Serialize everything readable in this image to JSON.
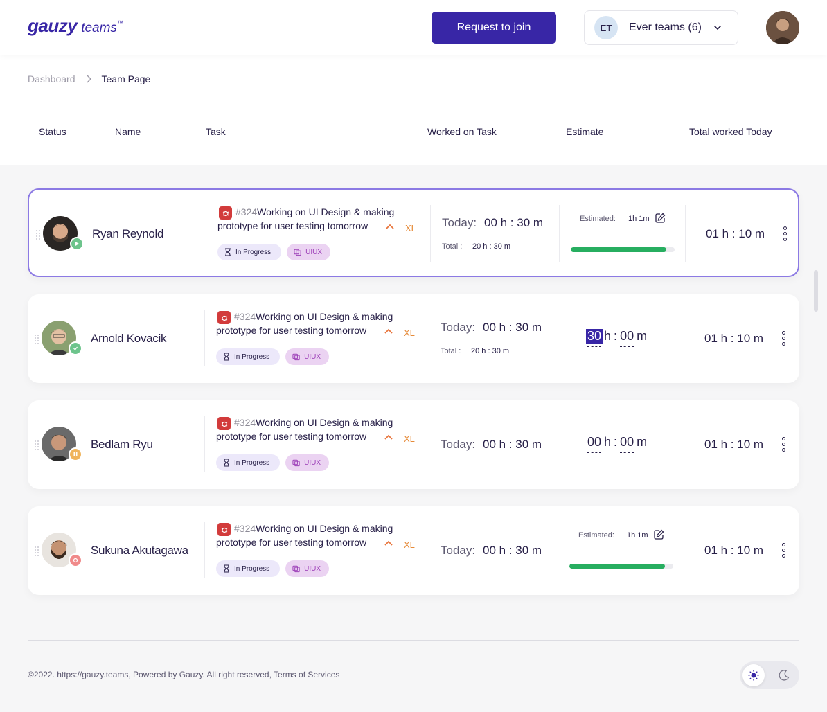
{
  "header": {
    "logo_main": "gauzy",
    "logo_sub": "teams",
    "logo_tm": "™",
    "join_button": "Request to join",
    "team_badge": "ET",
    "team_name": "Ever teams (6)"
  },
  "breadcrumb": {
    "parent": "Dashboard",
    "current": "Team Page"
  },
  "columns": {
    "status": "Status",
    "name": "Name",
    "task": "Task",
    "worked": "Worked on Task",
    "estimate": "Estimate",
    "total": "Total worked Today"
  },
  "colors": {
    "accent": "#3826a6",
    "progress": "#27ae60",
    "size": "#e68a38",
    "bug": "#d23b3b"
  },
  "rows": [
    {
      "name": "Ryan Reynold",
      "status": "working",
      "status_icon": "play-icon",
      "task_num": "#324",
      "task_title": "Working on UI Design & making prototype for user testing tomorrow",
      "size": "XL",
      "task_status": "In Progress",
      "task_label": "UIUX",
      "today_label": "Today:",
      "today_value": "00 h : 30 m",
      "total_label": "Total :",
      "total_value": "20 h : 30 m",
      "estimate_label": "Estimated:",
      "estimate_value": "1h 1m",
      "progress": 0.92,
      "worked_today": "01 h : 10 m"
    },
    {
      "name": "Arnold Kovacik",
      "status": "online",
      "status_icon": "check-icon",
      "task_num": "#324",
      "task_title": "Working on UI Design & making prototype for user testing tomorrow",
      "size": "XL",
      "task_status": "In Progress",
      "task_label": "UIUX",
      "today_label": "Today:",
      "today_value": "00 h : 30 m",
      "total_label": "Total :",
      "total_value": "20 h : 30 m",
      "est_hours": "30",
      "est_h_unit": "h",
      "est_colon": ":",
      "est_minutes": "00",
      "est_m_unit": "m",
      "worked_today": "01 h : 10 m"
    },
    {
      "name": "Bedlam Ryu",
      "status": "paused",
      "status_icon": "pause-icon",
      "task_num": "#324",
      "task_title": "Working on UI Design & making prototype for user testing tomorrow",
      "size": "XL",
      "task_status": "In Progress",
      "task_label": "UIUX",
      "today_label": "Today:",
      "today_value": "00 h : 30 m",
      "est_hours": "00",
      "est_h_unit": "h",
      "est_colon": ":",
      "est_minutes": "00",
      "est_m_unit": "m",
      "worked_today": "01 h : 10 m"
    },
    {
      "name": "Sukuna Akutagawa",
      "status": "stopped",
      "status_icon": "stop-icon",
      "task_num": "#324",
      "task_title": "Working on UI Design & making prototype for user testing tomorrow",
      "size": "XL",
      "task_status": "In Progress",
      "task_label": "UIUX",
      "today_label": "Today:",
      "today_value": "00 h : 30 m",
      "estimate_label": "Estimated:",
      "estimate_value": "1h 1m",
      "progress": 0.92,
      "worked_today": "01 h : 10 m"
    }
  ],
  "footer": {
    "text": "©2022. https://gauzy.teams, Powered by Gauzy. All right reserved, Terms of Services"
  }
}
